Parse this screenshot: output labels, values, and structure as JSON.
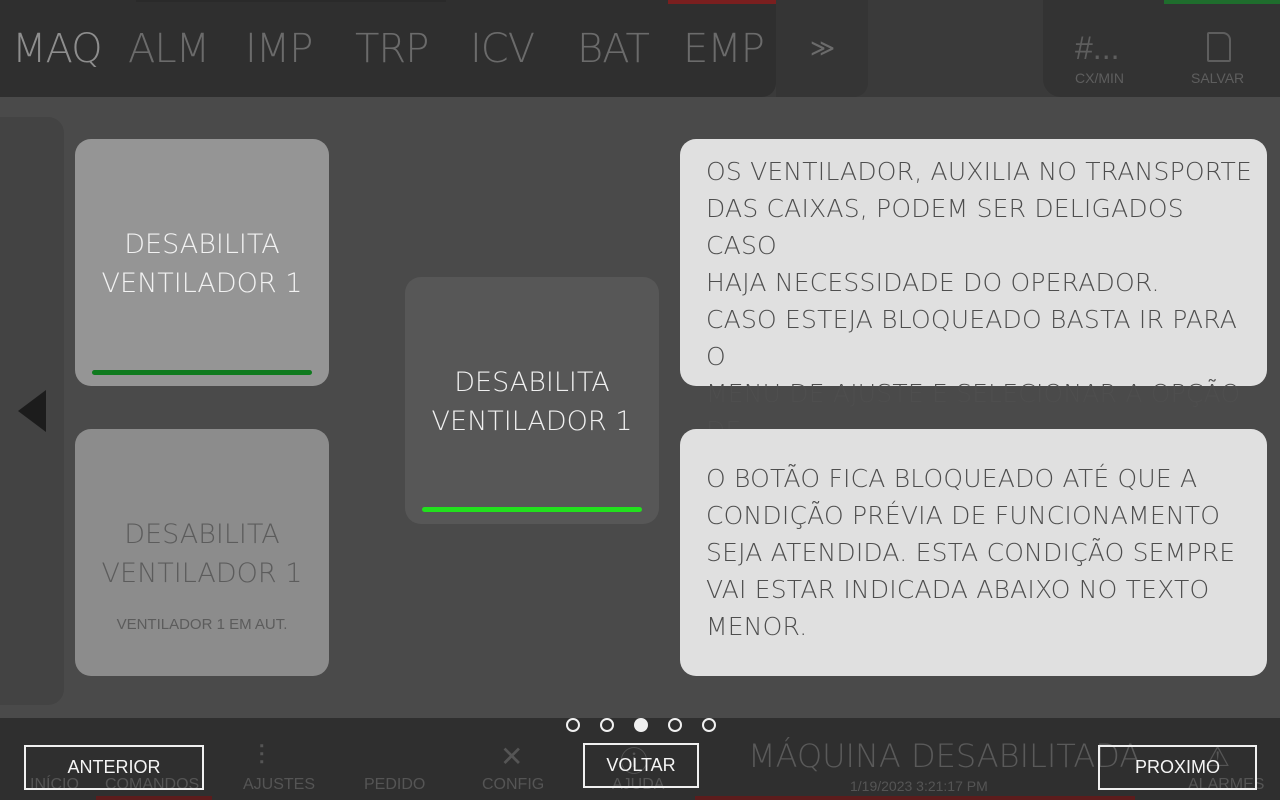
{
  "topbar": {
    "tabs": [
      "MAQ",
      "ALM",
      "IMP",
      "TRP",
      "ICV",
      "BAT",
      "EMP"
    ],
    "more_icon": "chevron-double-right-icon",
    "rate_value": "#...",
    "rate_label": "CX/MIN",
    "save_label": "SALVAR"
  },
  "tutorial": {
    "button_label_line1": "DESABILITA",
    "button_label_line2": "VENTILADOR 1",
    "disabled_subtext": "VENTILADOR 1 EM AUT.",
    "info_1": "OS VENTILADOR, AUXILIA NO TRANSPORTE\nDAS CAIXAS, PODEM SER DELIGADOS CASO\nHAJA NECESSIDADE DO OPERADOR.\nCASO ESTEJA BLOQUEADO BASTA IR PARA O\nMENU DE AJUSTE E SELECIONAR A OPÇÃO DE\nLIGAR MANUALMENTE.",
    "info_2": "O BOTÃO FICA BLOQUEADO ATÉ QUE A\nCONDIÇÃO PRÉVIA DE FUNCIONAMENTO\nSEJA ATENDIDA. ESTA CONDIÇÃO SEMPRE\nVAI ESTAR INDICADA ABAIXO NO TEXTO\nMENOR.",
    "page_count": 5,
    "current_page": 3
  },
  "bottombar": {
    "nav": [
      "INÍCIO",
      "COMANDOS",
      "AJUSTES",
      "PEDIDO",
      "CONFIG",
      "AJUDA",
      "ALARMES"
    ],
    "status": "MÁQUINA DESABILITADA",
    "timestamp": "1/19/2023 3:21:17 PM"
  },
  "buttons": {
    "prev": "ANTERIOR",
    "back": "VOLTAR",
    "next": "PROXIMO"
  },
  "colors": {
    "bar_enabled_dark": "#0f7a1e",
    "bar_enabled_bright": "#22e01e"
  }
}
